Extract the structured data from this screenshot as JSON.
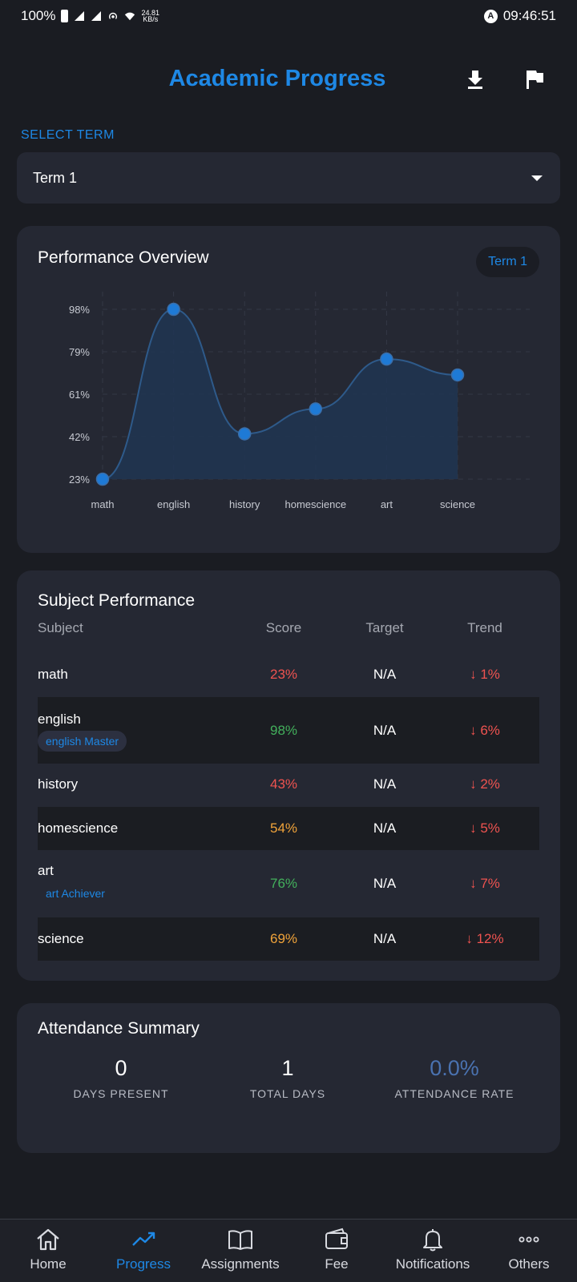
{
  "status_bar": {
    "battery": "100%",
    "net_speed_value": "24.81",
    "net_speed_unit": "KB/s",
    "alert_glyph": "A",
    "time": "09:46:51"
  },
  "header": {
    "title": "Academic Progress",
    "download_icon": "download-icon",
    "flag_icon": "flag-icon"
  },
  "term_select": {
    "label": "SELECT TERM",
    "value": "Term 1"
  },
  "performance": {
    "title": "Performance Overview",
    "badge": "Term 1"
  },
  "chart_data": {
    "type": "area",
    "categories": [
      "math",
      "english",
      "history",
      "homescience",
      "art",
      "science"
    ],
    "values": [
      23,
      98,
      43,
      54,
      76,
      69
    ],
    "y_ticks": [
      "98%",
      "79%",
      "61%",
      "42%",
      "23%"
    ],
    "ylim": [
      23,
      98
    ],
    "grid": true,
    "colors": {
      "line": "#2e5a8a",
      "fill": "#203552",
      "point": "#1e7ad6"
    }
  },
  "subjects": {
    "title": "Subject Performance",
    "headers": {
      "subject": "Subject",
      "score": "Score",
      "target": "Target",
      "trend": "Trend"
    },
    "rows": [
      {
        "name": "math",
        "score": "23%",
        "target": "N/A",
        "trend": "↓ 1%",
        "tag": ""
      },
      {
        "name": "english",
        "score": "98%",
        "target": "N/A",
        "trend": "↓ 6%",
        "tag": "english Master"
      },
      {
        "name": "history",
        "score": "43%",
        "target": "N/A",
        "trend": "↓ 2%",
        "tag": ""
      },
      {
        "name": "homescience",
        "score": "54%",
        "target": "N/A",
        "trend": "↓ 5%",
        "tag": ""
      },
      {
        "name": "art",
        "score": "76%",
        "target": "N/A",
        "trend": "↓ 7%",
        "tag": "art Achiever"
      },
      {
        "name": "science",
        "score": "69%",
        "target": "N/A",
        "trend": "↓ 12%",
        "tag": ""
      }
    ],
    "colors": {
      "low": "#ef5350",
      "mid": "#f0a33a",
      "high": "#43b05c"
    }
  },
  "attendance": {
    "title": "Attendance Summary",
    "days_present_value": "0",
    "days_present_label": "DAYS PRESENT",
    "total_days_value": "1",
    "total_days_label": "TOTAL DAYS",
    "rate_value": "0.0%",
    "rate_label": "ATTENDANCE RATE",
    "rate_color": "#4a72b0"
  },
  "nav": {
    "items": [
      {
        "label": "Home",
        "icon": "home-icon"
      },
      {
        "label": "Progress",
        "icon": "trending-up-icon",
        "active": true
      },
      {
        "label": "Assignments",
        "icon": "book-icon"
      },
      {
        "label": "Fee",
        "icon": "wallet-icon"
      },
      {
        "label": "Notifications",
        "icon": "bell-icon"
      },
      {
        "label": "Others",
        "icon": "more-icon"
      }
    ],
    "accent": "#1e88e5"
  }
}
